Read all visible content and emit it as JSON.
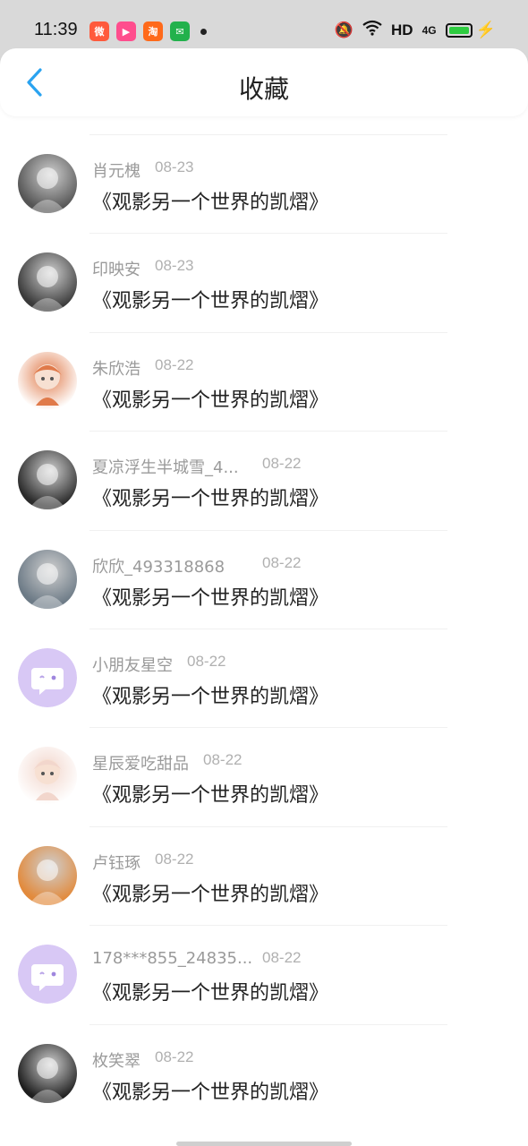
{
  "status_bar": {
    "time": "11:39",
    "network": "HD",
    "signal": "4G",
    "notifications": [
      {
        "icon": "weibo-icon",
        "color": "#ff5a3c"
      },
      {
        "icon": "kuaishou-icon",
        "color": "#ff4d8d"
      },
      {
        "icon": "taobao-icon",
        "color": "#ff6a1a"
      },
      {
        "icon": "message-icon",
        "color": "#22b14c"
      }
    ]
  },
  "header": {
    "title": "收藏"
  },
  "items": [
    {
      "name": "肖元槐",
      "date": "08-23",
      "title": "《观影另一个世界的凯熠》",
      "avatar": "photo",
      "color": "#555"
    },
    {
      "name": "印映安",
      "date": "08-23",
      "title": "《观影另一个世界的凯熠》",
      "avatar": "photo",
      "color": "#3a3a3a"
    },
    {
      "name": "朱欣浩",
      "date": "08-22",
      "title": "《观影另一个世界的凯熠》",
      "avatar": "cartoon",
      "color": "#e07a4a"
    },
    {
      "name": "夏凉浮生半城雪_4...",
      "date": "08-22",
      "title": "《观影另一个世界的凯熠》",
      "avatar": "photo",
      "color": "#2b2b2b"
    },
    {
      "name": "欣欣_493318868",
      "date": "08-22",
      "title": "《观影另一个世界的凯熠》",
      "avatar": "photo",
      "color": "#6c7a86"
    },
    {
      "name": "小朋友星空",
      "date": "08-22",
      "title": "《观影另一个世界的凯熠》",
      "avatar": "default",
      "color": "#d9ccf5"
    },
    {
      "name": "星辰爱吃甜品",
      "date": "08-22",
      "title": "《观影另一个世界的凯熠》",
      "avatar": "cartoon",
      "color": "#f2d6cc"
    },
    {
      "name": "卢钰琢",
      "date": "08-22",
      "title": "《观影另一个世界的凯熠》",
      "avatar": "photo",
      "color": "#e28a3c"
    },
    {
      "name": "178***855_24835...",
      "date": "08-22",
      "title": "《观影另一个世界的凯熠》",
      "avatar": "default",
      "color": "#d9ccf5"
    },
    {
      "name": "枚笑翠",
      "date": "08-22",
      "title": "《观影另一个世界的凯熠》",
      "avatar": "photo",
      "color": "#1e1e1e"
    }
  ]
}
